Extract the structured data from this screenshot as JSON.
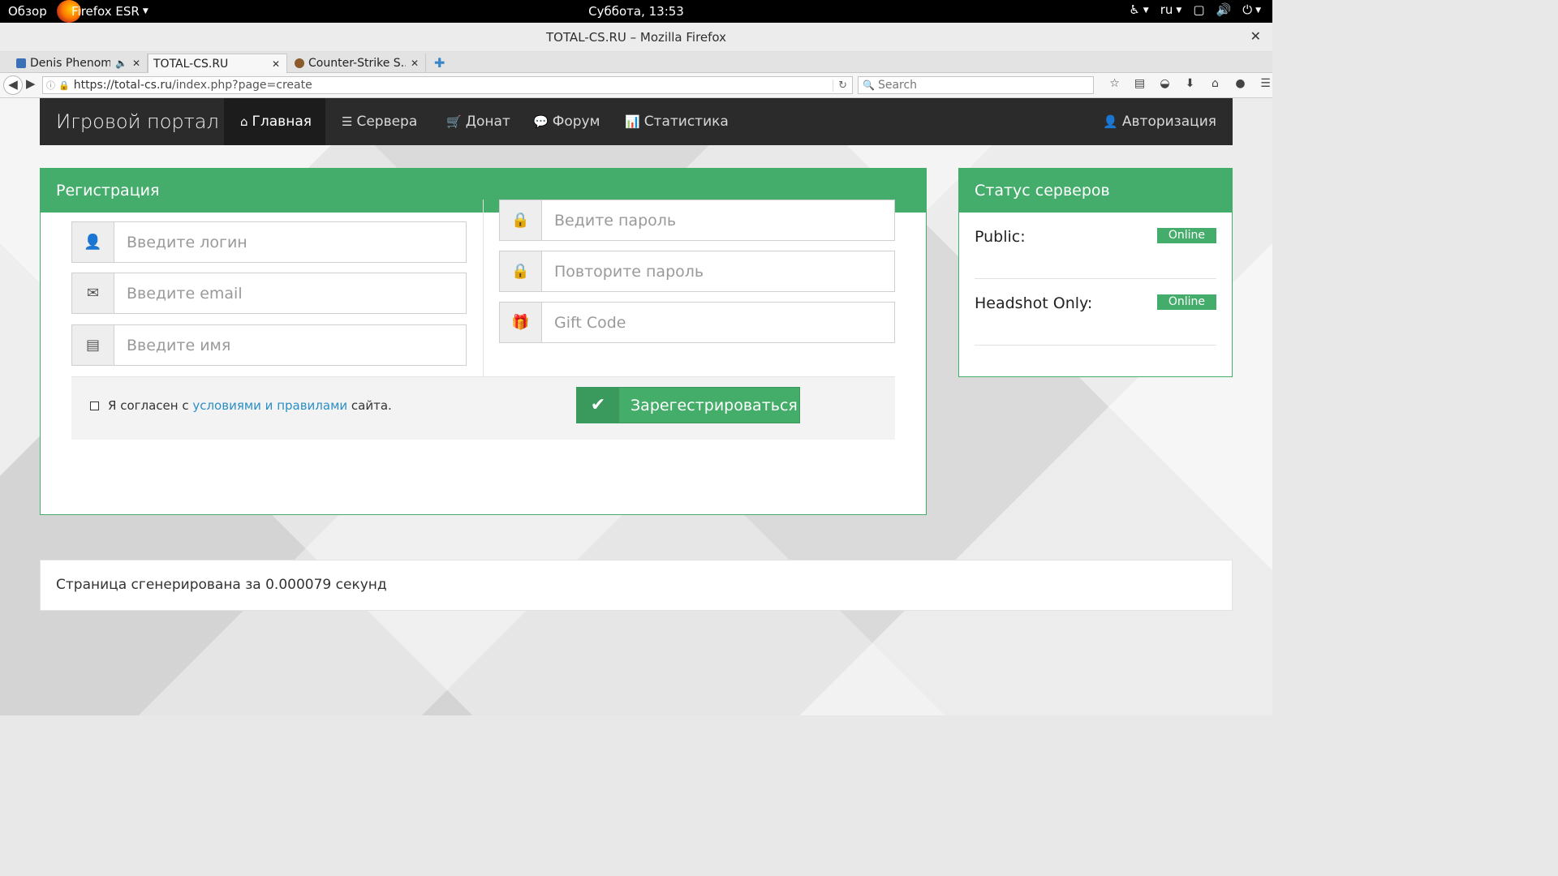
{
  "gnome": {
    "activities": "Обзор",
    "app_name": "Firefox ESR",
    "clock": "Суббота, 13:53",
    "lang": "ru"
  },
  "window": {
    "title": "TOTAL-CS.RU – Mozilla Firefox"
  },
  "tabs": [
    {
      "label": "Denis Phenom...",
      "favicon_color": "#3b6fb6"
    },
    {
      "label": "TOTAL-CS.RU",
      "favicon_color": "#ffffff"
    },
    {
      "label": "Counter-Strike S...",
      "favicon_color": "#8a5a2b"
    }
  ],
  "navbar": {
    "url_host": "https://total-cs.ru",
    "url_path": "/index.php?page=create",
    "search_placeholder": "Search"
  },
  "site": {
    "brand": "Игровой портал",
    "menu": [
      {
        "label": "Главная",
        "icon": "home-icon",
        "glyph": "⌂"
      },
      {
        "label": "Сервера",
        "icon": "list-icon",
        "glyph": "☰"
      },
      {
        "label": "Донат",
        "icon": "cart-icon",
        "glyph": "🛒"
      },
      {
        "label": "Форум",
        "icon": "comments-icon",
        "glyph": "💬"
      },
      {
        "label": "Статистика",
        "icon": "bar-chart-icon",
        "glyph": "📊"
      }
    ],
    "auth_label": "Авторизация"
  },
  "registration": {
    "title": "Регистрация",
    "login_placeholder": "Введите логин",
    "email_placeholder": "Введите email",
    "name_placeholder": "Введите имя",
    "password_placeholder": "Ведите пароль",
    "password_repeat_placeholder": "Повторите пароль",
    "gift_placeholder": "Gift Code",
    "agree_prefix": "Я согласен с ",
    "agree_link": "условиями и правилами",
    "agree_suffix": " сайта.",
    "submit_label": "Зарегестрироваться"
  },
  "status": {
    "title": "Статус серверов",
    "servers": [
      {
        "name": "Public:",
        "state": "Online"
      },
      {
        "name": "Headshot Only:",
        "state": "Online"
      }
    ]
  },
  "footer": {
    "text": "Страница сгенерирована за 0.000079 секунд"
  }
}
